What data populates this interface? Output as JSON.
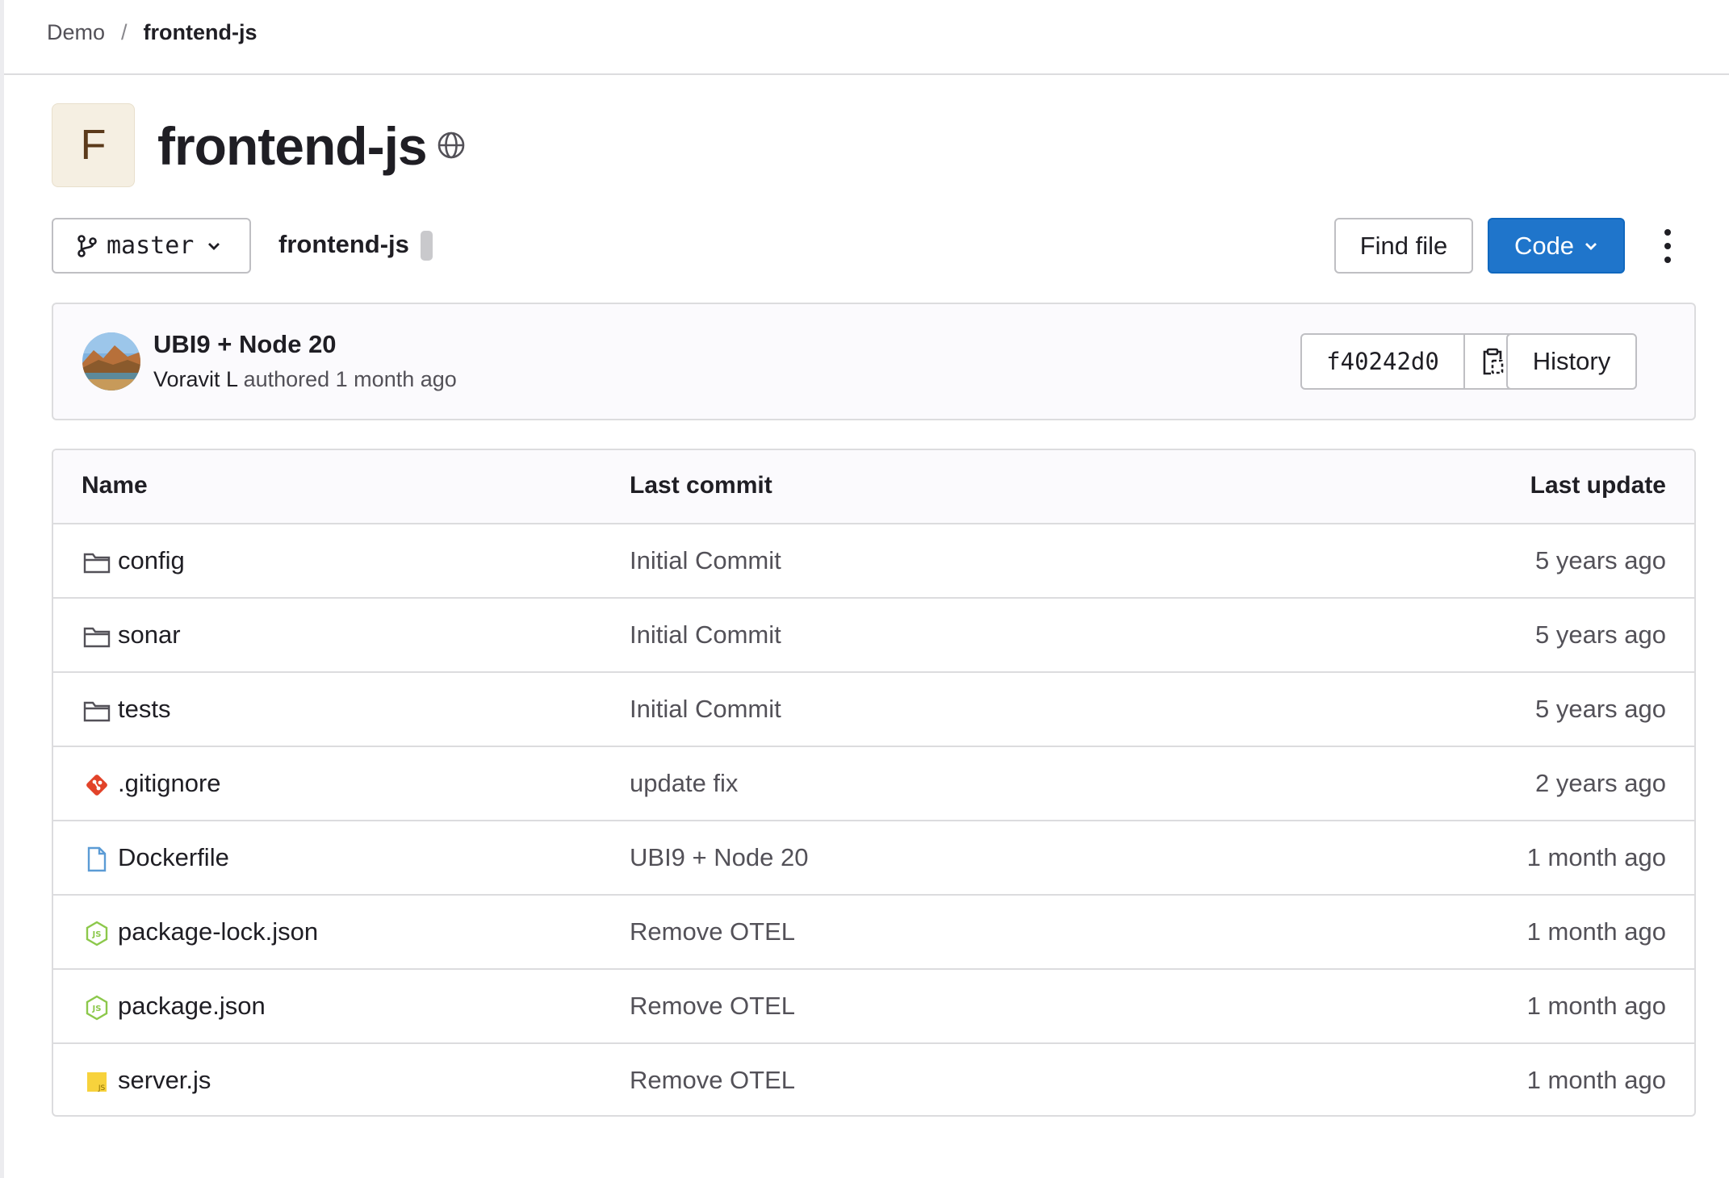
{
  "breadcrumb": {
    "group": "Demo",
    "separator": "/",
    "project": "frontend-js"
  },
  "project": {
    "avatar_letter": "F",
    "title": "frontend-js",
    "visibility_icon": "globe-icon"
  },
  "toolbar": {
    "branch": "master",
    "path": "frontend-js",
    "find_file_label": "Find file",
    "code_label": "Code",
    "more_icon": "kebab-icon"
  },
  "last_commit": {
    "title": "UBI9 + Node 20",
    "author": "Voravit L",
    "authored_text": "authored 1 month ago",
    "sha": "f40242d0",
    "history_label": "History"
  },
  "tree": {
    "headers": {
      "name": "Name",
      "last_commit": "Last commit",
      "last_update": "Last update"
    },
    "rows": [
      {
        "name": "config",
        "icon": "folder-icon",
        "commit": "Initial Commit",
        "updated": "5 years ago"
      },
      {
        "name": "sonar",
        "icon": "folder-icon",
        "commit": "Initial Commit",
        "updated": "5 years ago"
      },
      {
        "name": "tests",
        "icon": "folder-icon",
        "commit": "Initial Commit",
        "updated": "5 years ago"
      },
      {
        "name": ".gitignore",
        "icon": "git-icon",
        "commit": "update fix",
        "updated": "2 years ago"
      },
      {
        "name": "Dockerfile",
        "icon": "file-icon",
        "commit": "UBI9 + Node 20",
        "updated": "1 month ago"
      },
      {
        "name": "package-lock.json",
        "icon": "nodejs-icon",
        "commit": "Remove OTEL",
        "updated": "1 month ago"
      },
      {
        "name": "package.json",
        "icon": "nodejs-icon",
        "commit": "Remove OTEL",
        "updated": "1 month ago"
      },
      {
        "name": "server.js",
        "icon": "javascript-icon",
        "commit": "Remove OTEL",
        "updated": "1 month ago"
      }
    ]
  },
  "colors": {
    "primary": "#1f75cb",
    "border": "#dcdcde",
    "git": "#e24329",
    "node": "#8cc84b",
    "js": "#f7d23c",
    "file": "#5b9bd5"
  }
}
